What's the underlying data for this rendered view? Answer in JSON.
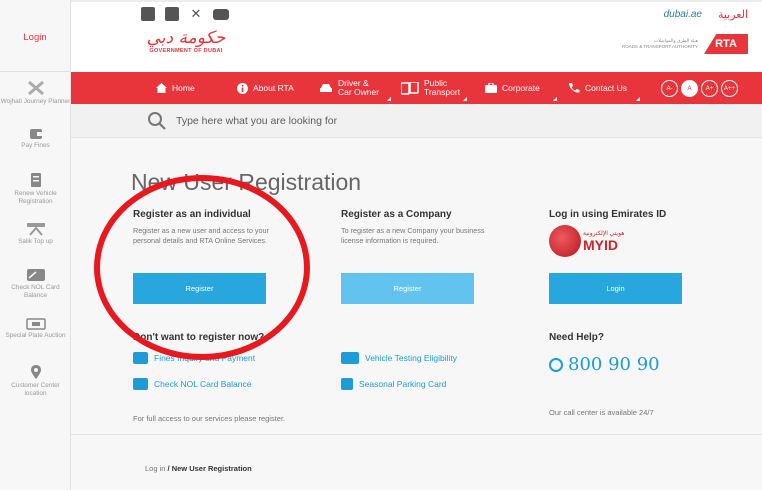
{
  "sidebar": {
    "login": "Login",
    "items": [
      {
        "label": "Wojhati Journey Planner",
        "icon": "route-icon"
      },
      {
        "label": "Pay Fines",
        "icon": "wallet-icon"
      },
      {
        "label": "Renew Vehicle Registration",
        "icon": "document-icon"
      },
      {
        "label": "Salik Top up",
        "icon": "salik-gate-icon"
      },
      {
        "label": "Check NOL Card Balance",
        "icon": "nol-card-icon"
      },
      {
        "label": "Special Plate Auction",
        "icon": "plate-icon"
      },
      {
        "label": "Customer Center location",
        "icon": "location-pin-icon"
      }
    ]
  },
  "topbar": {
    "social": [
      "facebook-icon",
      "instagram-icon",
      "twitter-icon",
      "youtube-icon"
    ],
    "dubai_logo": "dubai.ae",
    "language": "العربية"
  },
  "header": {
    "gov_logo_text": "حكومة دبي",
    "gov_caption": "GOVERNMENT OF DUBAI",
    "rta_text_ar": "هيئة الطرق والمواصلات",
    "rta_text_en": "ROADS & TRANSPORT AUTHORITY",
    "rta_mark": "RTA"
  },
  "nav": {
    "items": [
      {
        "label": "Home",
        "icon": "home-icon"
      },
      {
        "label": "About RTA",
        "icon": "info-icon"
      },
      {
        "label1": "Driver &",
        "label2": "Car Owner",
        "icon": "car-icon"
      },
      {
        "label1": "Public",
        "label2": "Transport",
        "icon": "bus-icon"
      },
      {
        "label": "Corporate",
        "icon": "briefcase-icon"
      },
      {
        "label": "Contact Us",
        "icon": "phone-icon"
      }
    ],
    "accessibility": [
      "A-",
      "A",
      "A+",
      "A++"
    ]
  },
  "search": {
    "placeholder": "Type here what you are looking for"
  },
  "main": {
    "title": "New User Registration",
    "individual": {
      "title": "Register as an individual",
      "text": "Register as a new user and access to your personal details and RTA Online Services.",
      "button": "Register"
    },
    "company": {
      "title": "Register as a Company",
      "text": "To register as a new Company your business license information is required.",
      "button": "Register"
    },
    "emirates": {
      "title": "Log in using Emirates ID",
      "logo_small": "هويتي الإلكترونية",
      "logo_big": "MYID",
      "button": "Login"
    },
    "later": {
      "title": "Don't want to register now?",
      "links": [
        "Fines Inquiry and Payment",
        "Check NOL Card Balance",
        "Vehicle Testing Eligibility",
        "Seasonal Parking Card"
      ],
      "note": "For full access to our services please register."
    },
    "help": {
      "title": "Need Help?",
      "phone": "800 90 90",
      "note": "Our call center is available 24/7"
    },
    "breadcrumb": {
      "first": "Log in",
      "sep": " / ",
      "current": "New User Registration"
    }
  },
  "colors": {
    "brand_red": "#e8353c",
    "button_blue": "#28a6de",
    "link_blue": "#1d9cd8",
    "annotation_red": "#e8191e"
  }
}
